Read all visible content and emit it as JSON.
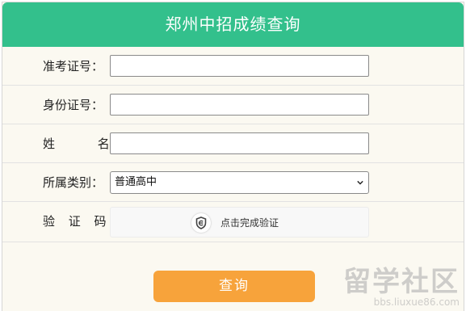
{
  "header": {
    "title": "郑州中招成绩查询"
  },
  "form": {
    "exam_id_label": "准考证号：",
    "id_card_label": "身份证号：",
    "name_label": "姓 名：",
    "category_label": "所属类别：",
    "captcha_label": "验 证 码：",
    "category_value": "普通高中",
    "captcha_prompt": "点击完成验证",
    "exam_id_value": "",
    "id_card_value": "",
    "name_value": ""
  },
  "actions": {
    "submit_label": "查询"
  },
  "watermark": {
    "main": "留学社区",
    "sub": "bbs.liuxue86.com"
  },
  "colors": {
    "header": "#33c08c",
    "button": "#f7a33b",
    "panel": "#fbf9f1"
  },
  "icons": {
    "captcha": "shield-check-icon",
    "select": "chevron-down-icon"
  }
}
